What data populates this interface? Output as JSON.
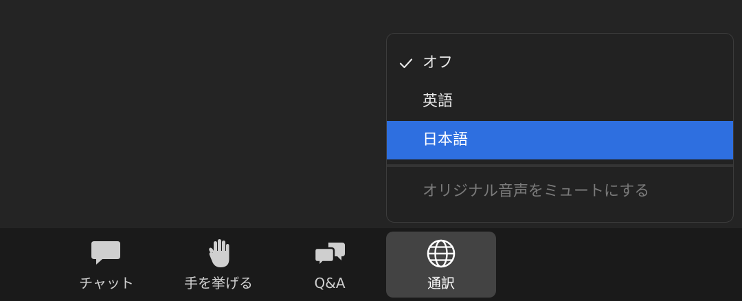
{
  "toolbar": {
    "buttons": [
      {
        "label": "チャット",
        "icon": "chat-bubble-icon",
        "active": false
      },
      {
        "label": "手を挙げる",
        "icon": "raise-hand-icon",
        "active": false
      },
      {
        "label": "Q&A",
        "icon": "qa-bubbles-icon",
        "active": false
      },
      {
        "label": "通訳",
        "icon": "globe-icon",
        "active": true
      }
    ]
  },
  "interpretation_menu": {
    "items": [
      {
        "label": "オフ",
        "checked": true,
        "highlighted": false,
        "disabled": false
      },
      {
        "label": "英語",
        "checked": false,
        "highlighted": false,
        "disabled": false
      },
      {
        "label": "日本語",
        "checked": false,
        "highlighted": true,
        "disabled": false
      }
    ],
    "mute_original_label": "オリジナル音声をミュートにする",
    "mute_original_disabled": true
  },
  "colors": {
    "meeting_background": "#242424",
    "toolbar_background": "#1a1a1a",
    "menu_background": "#222222",
    "highlight": "#2e6fe0",
    "active_button": "#434343"
  }
}
